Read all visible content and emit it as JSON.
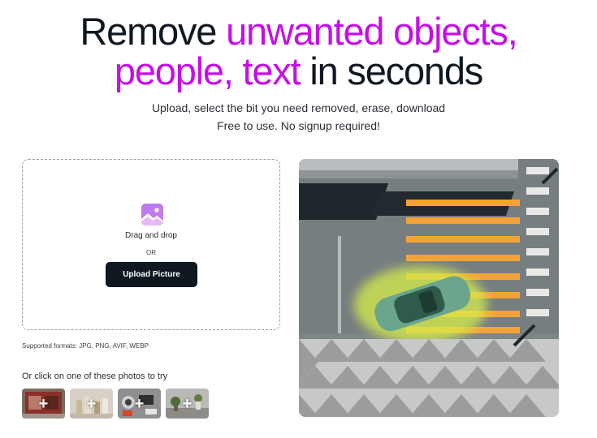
{
  "hero": {
    "title_part1": "Remove ",
    "title_highlight1": "unwanted objects,",
    "title_highlight2": "people, text",
    "title_part2": " in seconds",
    "subtitle_line1": "Upload, select the bit you need removed, erase, download",
    "subtitle_line2": "Free to use. No signup required!"
  },
  "upload": {
    "drag_label": "Drag and drop",
    "or_label": "OR",
    "button_label": "Upload Picture",
    "icon": "image-icon"
  },
  "formats_text": "Supported formats: JPG, PNG, AVIF, WEBP",
  "samples": {
    "label": "Or click on one of these photos to try",
    "items": [
      {
        "name": "storefront-sample",
        "plus": "+"
      },
      {
        "name": "bottles-sample",
        "plus": "+"
      },
      {
        "name": "desk-items-sample",
        "plus": "+"
      },
      {
        "name": "plants-sample",
        "plus": "+"
      }
    ]
  },
  "colors": {
    "accent": "#c50fe8",
    "dark": "#0f1720",
    "mask": "#c8e84a"
  }
}
